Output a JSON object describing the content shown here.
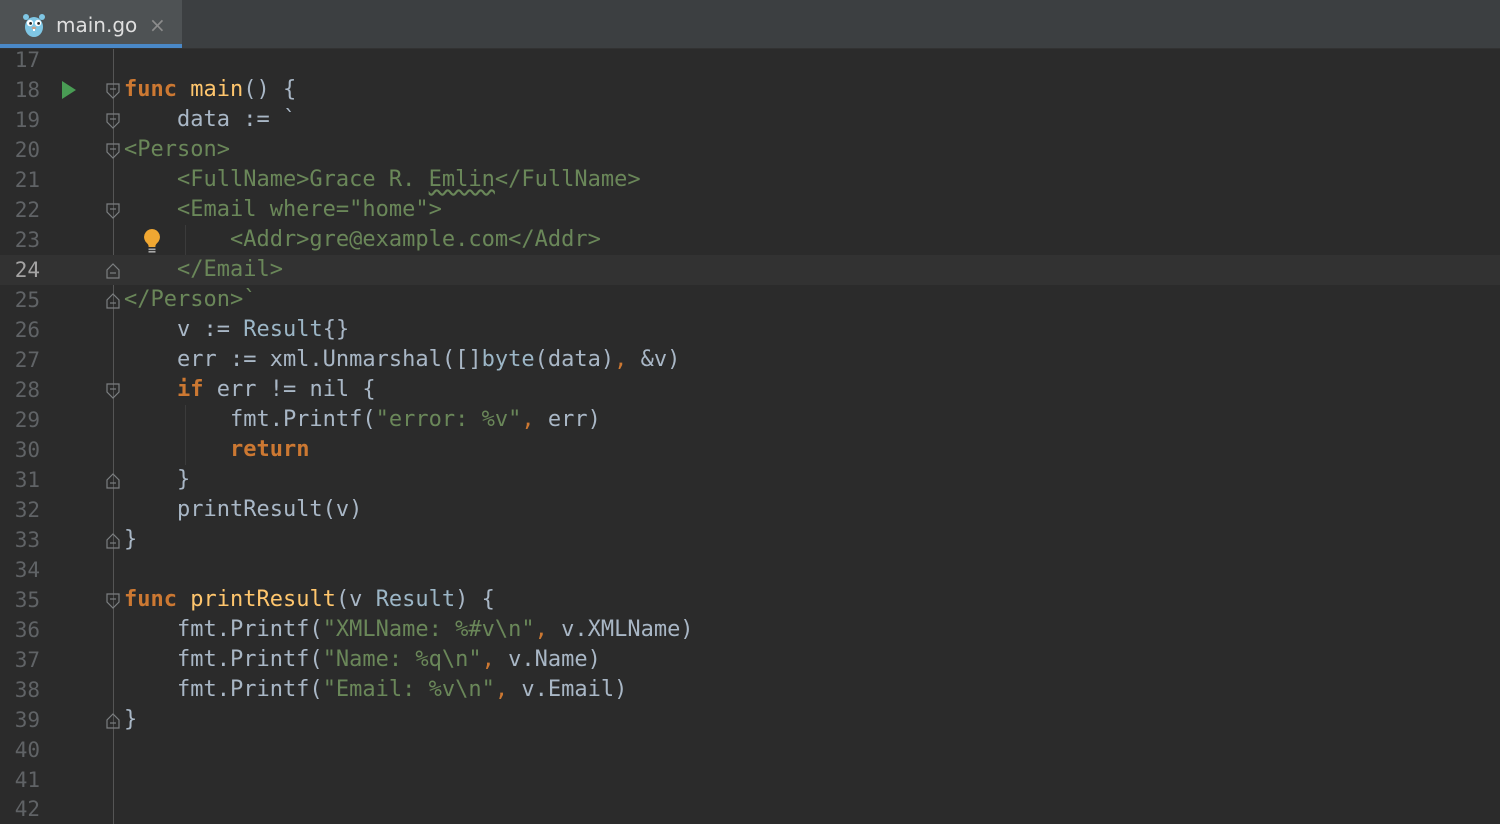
{
  "tab": {
    "label": "main.go",
    "close": "×",
    "icon": "gopher-icon"
  },
  "editor": {
    "current_line": "24",
    "lines": [
      {
        "n": "17"
      },
      {
        "n": "18"
      },
      {
        "n": "19"
      },
      {
        "n": "20"
      },
      {
        "n": "21"
      },
      {
        "n": "22"
      },
      {
        "n": "23"
      },
      {
        "n": "24"
      },
      {
        "n": "25"
      },
      {
        "n": "26"
      },
      {
        "n": "27"
      },
      {
        "n": "28"
      },
      {
        "n": "29"
      },
      {
        "n": "30"
      },
      {
        "n": "31"
      },
      {
        "n": "32"
      },
      {
        "n": "33"
      },
      {
        "n": "34"
      },
      {
        "n": "35"
      },
      {
        "n": "36"
      },
      {
        "n": "37"
      },
      {
        "n": "38"
      },
      {
        "n": "39"
      },
      {
        "n": "40"
      },
      {
        "n": "41"
      },
      {
        "n": "42"
      }
    ],
    "code": {
      "l18": {
        "kw": "func",
        "name": "main",
        "rest": "() {"
      },
      "l19": "    data := `",
      "l20": "<Person>",
      "l21": {
        "pre": "    <FullName>Grace R. ",
        "squig": "Emlin",
        "post": "</FullName>"
      },
      "l22": "    <Email where=\"home\">",
      "l23": "        <Addr>gre@example.com</Addr>",
      "l24": "    </Email>",
      "l25": "</Person>`",
      "l26": {
        "a": "    v := ",
        "ty": "Result",
        "b": "{}"
      },
      "l27": {
        "a": "    err := xml.Unmarshal([]",
        "ty": "byte",
        "b": "(data)",
        "comma": ",",
        "c": " &v)"
      },
      "l28": {
        "kw": "if",
        "pre": "    ",
        "rest": " err != nil {"
      },
      "l29": {
        "a": "        fmt.Printf(",
        "str": "\"error: %v\"",
        "comma": ",",
        "b": " err)"
      },
      "l30": {
        "pre": "        ",
        "kw": "return"
      },
      "l31": "    }",
      "l32": "    printResult(v)",
      "l33": "}",
      "l35": {
        "kw": "func",
        "name": "printResult",
        "a": "(v ",
        "ty": "Result",
        "b": ") {"
      },
      "l36": {
        "a": "    fmt.Printf(",
        "str": "\"XMLName: %#v\\n\"",
        "comma": ",",
        "b": " v.XMLName)"
      },
      "l37": {
        "a": "    fmt.Printf(",
        "str": "\"Name: %q\\n\"",
        "comma": ",",
        "b": " v.Name)"
      },
      "l38": {
        "a": "    fmt.Printf(",
        "str": "\"Email: %v\\n\"",
        "comma": ",",
        "b": " v.Email)"
      },
      "l39": "}"
    }
  },
  "colors": {
    "background": "#2b2b2b",
    "keyword": "#cc7832",
    "function": "#ffc66d",
    "string": "#6a8759",
    "type": "#9cb6c6",
    "text": "#a9b7c6",
    "run": "#499c54",
    "tab_underline": "#4a88c7"
  }
}
